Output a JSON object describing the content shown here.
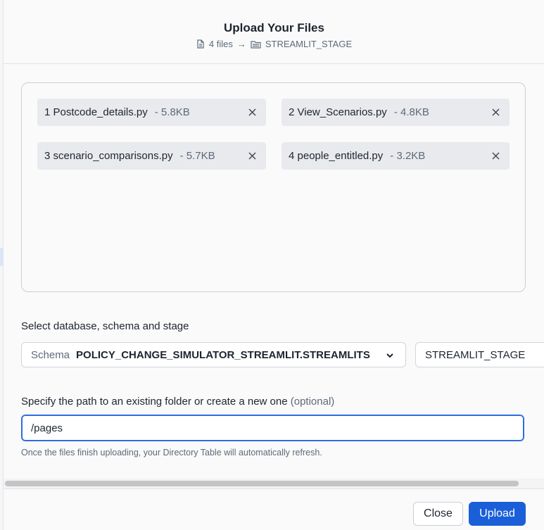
{
  "modal": {
    "title": "Upload Your Files",
    "file_count": "4 files",
    "arrow": "→",
    "stage_name": "STREAMLIT_STAGE"
  },
  "files": [
    {
      "name": "1 Postcode_details.py",
      "size": "- 5.8KB"
    },
    {
      "name": "2 View_Scenarios.py",
      "size": "- 4.8KB"
    },
    {
      "name": "3 scenario_comparisons.py",
      "size": "- 5.7KB"
    },
    {
      "name": "4 people_entitled.py",
      "size": "- 3.2KB"
    }
  ],
  "location": {
    "label": "Select database, schema and stage",
    "schema_prefix": "Schema",
    "schema_value": "POLICY_CHANGE_SIMULATOR_STREAMLIT.STREAMLITS",
    "stage_value": "STREAMLIT_STAGE"
  },
  "path": {
    "label": "Specify the path to an existing folder or create a new one",
    "optional": "(optional)",
    "value": "/pages",
    "hint": "Once the files finish uploading, your Directory Table will automatically refresh."
  },
  "footer": {
    "close_label": "Close",
    "upload_label": "Upload"
  },
  "colors": {
    "primary": "#1a5fd8",
    "chip_bg": "#e9eaed",
    "focus_border": "#2d6cdf"
  }
}
